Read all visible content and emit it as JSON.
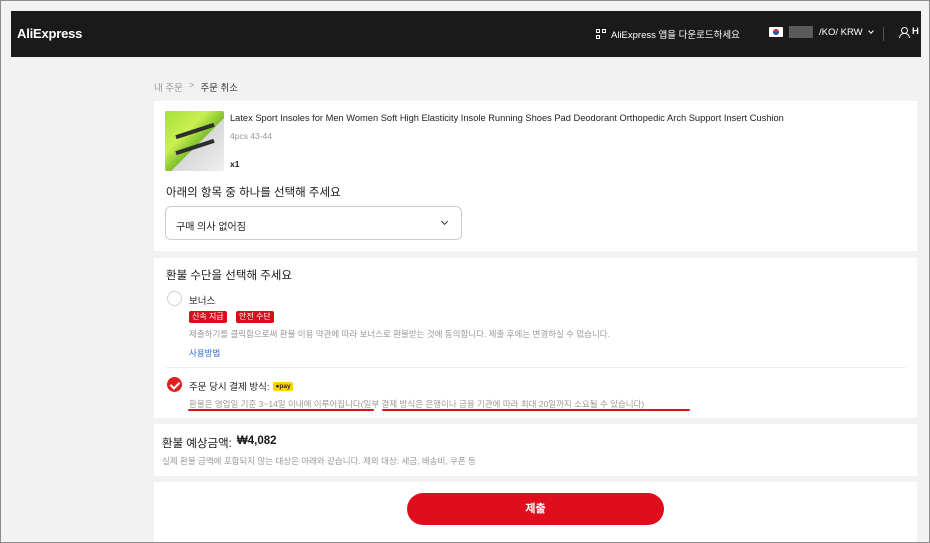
{
  "header": {
    "logo": "AliExpress",
    "app_download": "AliExpress 앱을 다운로드하세요",
    "locale": "/KO/ KRW",
    "user_label": "H"
  },
  "breadcrumb": {
    "parent": "내 주문",
    "separator": ">",
    "current": "주문 취소"
  },
  "product": {
    "title": "Latex Sport Insoles for Men Women Soft High Elasticity Insole Running Shoes Pad Deodorant Orthopedic Arch Support Insert Cushion",
    "spec": "4pcs 43-44",
    "qty": "x1"
  },
  "reason": {
    "label": "아래의 항목 중 하나를 선택해 주세요",
    "selected": "구매 의사 없어짐"
  },
  "refund_method": {
    "label": "환불 수단을 선택해 주세요",
    "option1": {
      "title": "보너스",
      "tags": [
        "신속 지급",
        "안전 수단"
      ],
      "desc": "제출하기를 클릭함으로써 환불 이용 약관에 따라 보너스로 환불받는 것에 동의합니다. 제출 후에는 변경하실 수 없습니다.",
      "link": "사용방법",
      "checked": false
    },
    "option2": {
      "title": "주문 당시 결제 방식:",
      "badge": "●pay",
      "desc": "환불은 영업일 기준 3~14일 이내에 이루어집니다(일부 결제 방식은 은행이나 금융 기관에 따라 최대 20일까지 소요될 수 있습니다)",
      "checked": true
    }
  },
  "refund_summary": {
    "label": "환불 예상금액:",
    "amount": "₩4,082",
    "note": "실제 환불 금액에 포함되지 않는 대상은 아래와 같습니다. 제외 대상: 세금, 배송비, 쿠폰 등"
  },
  "submit_label": "제출",
  "colors": {
    "accent": "#e00d1d",
    "header_bg": "#1a1a1a",
    "link": "#2b6ad9"
  }
}
